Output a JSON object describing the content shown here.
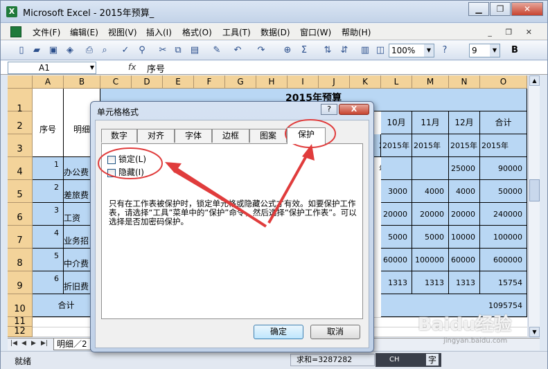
{
  "window": {
    "title": "Microsoft Excel - 2015年预算_",
    "icon": "excel-icon"
  },
  "menu": [
    "文件(F)",
    "编辑(E)",
    "视图(V)",
    "插入(I)",
    "格式(O)",
    "工具(T)",
    "数据(D)",
    "窗口(W)",
    "帮助(H)"
  ],
  "toolbar": {
    "zoom": "100%",
    "font_size": "9",
    "bold": "B"
  },
  "formula": {
    "name_box": "A1",
    "fx": "fx",
    "value": "序号"
  },
  "sheet": {
    "columns": [
      "A",
      "B",
      "C",
      "D",
      "E",
      "F",
      "G",
      "H",
      "I",
      "J",
      "K",
      "L",
      "M",
      "N",
      "O"
    ],
    "rows": [
      "1",
      "2",
      "3",
      "4",
      "5",
      "6",
      "7",
      "8",
      "9",
      "10",
      "11",
      "12"
    ],
    "title": "2015年预算",
    "header_a": "序号",
    "header_b": "明细",
    "months": [
      "10月",
      "11月",
      "12月",
      "合计"
    ],
    "years": [
      "2015年",
      "2015年",
      "2015年",
      "2015年",
      "2015年"
    ],
    "items": [
      {
        "no": "1",
        "name": "办公费",
        "l": "",
        "m": "",
        "n": "25000",
        "o": "90000"
      },
      {
        "no": "2",
        "name": "差旅费",
        "l": "3000",
        "m": "4000",
        "n": "4000",
        "o": "50000"
      },
      {
        "no": "3",
        "name": "工资",
        "l": "20000",
        "m": "20000",
        "n": "20000",
        "o": "240000"
      },
      {
        "no": "4",
        "name": "业务招",
        "l": "5000",
        "m": "5000",
        "n": "10000",
        "o": "100000"
      },
      {
        "no": "5",
        "name": "中介费",
        "l": "60000",
        "m": "100000",
        "n": "60000",
        "o": "600000"
      },
      {
        "no": "6",
        "name": "折旧费",
        "l": "1313",
        "m": "1313",
        "n": "1313",
        "o": "15754"
      }
    ],
    "total_label": "合计",
    "total_value": "1095754",
    "tab_label": "明细／2"
  },
  "status": {
    "ready": "就绪",
    "sum": "求和=3287282",
    "ime": "CH",
    "ime_char": "字"
  },
  "dialog": {
    "title": "单元格格式",
    "help": "?",
    "close": "X",
    "tabs": [
      "数字",
      "对齐",
      "字体",
      "边框",
      "图案",
      "保护"
    ],
    "active_tab": "保护",
    "locked_label": "锁定(L)",
    "hidden_label": "隐藏(I)",
    "description": "只有在工作表被保护时，锁定单元格或隐藏公式才有效。如要保护工作表，请选择“工具”菜单中的“保护”命令，然后选择“保护工作表”。可以选择是否加密码保护。",
    "ok": "确定",
    "cancel": "取消"
  },
  "colors": {
    "accent_red": "#e03c3c",
    "cell_blue": "#b9d7f4",
    "header": "#f3d39a"
  },
  "watermark": {
    "text": "Baidu经验",
    "sub": "jingyan.baidu.com"
  }
}
